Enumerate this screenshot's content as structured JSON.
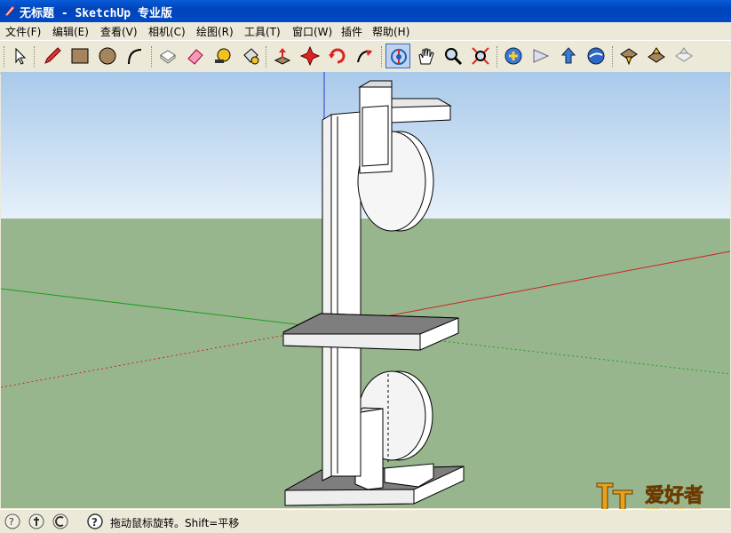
{
  "window": {
    "title": "无标题 - SketchUp 专业版"
  },
  "menu": [
    "文件(F)",
    "编辑(E)",
    "查看(V)",
    "相机(C)",
    "绘图(R)",
    "工具(T)",
    "窗口(W)",
    "插件",
    "帮助(H)"
  ],
  "toolbar": {
    "tools": [
      "select-icon",
      "pencil-icon",
      "rectangle-icon",
      "circle-icon",
      "arc-icon",
      "make-component-icon",
      "eraser-icon",
      "tape-measure-icon",
      "paint-bucket-icon",
      "push-pull-icon",
      "move-icon",
      "rotate-icon",
      "follow-me-icon",
      "orbit-icon",
      "pan-icon",
      "zoom-icon",
      "zoom-extents-icon",
      "get-models-icon",
      "share-model-icon",
      "upload-icon",
      "google-earth-icon",
      "get-current-view-icon",
      "toggle-terrain-icon",
      "place-model-icon"
    ],
    "active_tool": "orbit-icon"
  },
  "status": {
    "message": "拖动鼠标旋转。Shift=平移"
  },
  "watermark": {
    "text": "爱好者",
    "url": "www.zuojiaju.com"
  },
  "colors": {
    "sky": "#cfe2f3",
    "ground": "#98b68e",
    "titlebar": "#0a55d0"
  }
}
